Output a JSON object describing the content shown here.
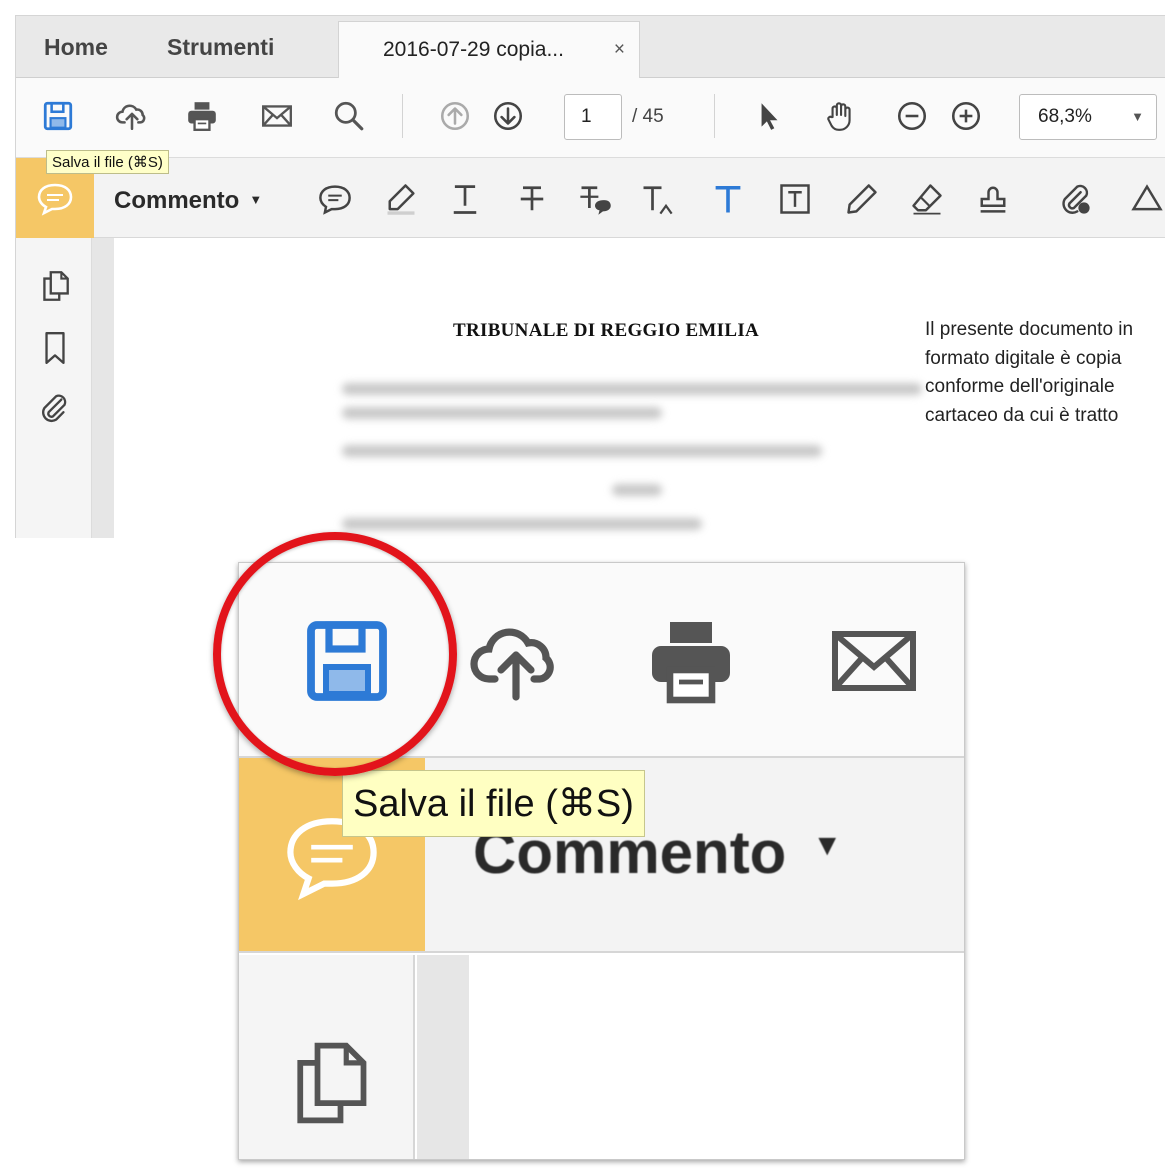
{
  "tabs": {
    "home": "Home",
    "tools": "Strumenti",
    "document": "2016-07-29 copia...",
    "close": "×"
  },
  "toolbar": {
    "page_current": "1",
    "page_total": "/ 45",
    "zoom_value": "68,3%",
    "icons": [
      "save-icon",
      "cloud-upload-icon",
      "print-icon",
      "email-icon",
      "search-icon",
      "page-up-icon",
      "page-down-icon",
      "select-arrow-icon",
      "hand-icon",
      "zoom-out-icon",
      "zoom-in-icon"
    ]
  },
  "comment_toolbar": {
    "label": "Commento",
    "caret": "▾",
    "icons": [
      "sticky-note-icon",
      "highlight-icon",
      "underline-text-icon",
      "strikethrough-icon",
      "replace-text-icon",
      "insert-text-icon",
      "add-text-icon",
      "text-box-icon",
      "pencil-icon",
      "eraser-icon",
      "stamp-icon",
      "attach-icon",
      "shapes-icon"
    ]
  },
  "tooltip": {
    "save": "Salva il file (⌘S)"
  },
  "document": {
    "title": "TRIBUNALE DI REGGIO EMILIA",
    "note": "Il presente documento in formato digitale è copia conforme dell'originale cartaceo da cui è tratto"
  },
  "colors": {
    "accent_blue": "#2d7ad6",
    "comment_badge": "#f5c766",
    "tooltip_bg": "#ffffc2",
    "highlight_ring": "#e2141b"
  }
}
